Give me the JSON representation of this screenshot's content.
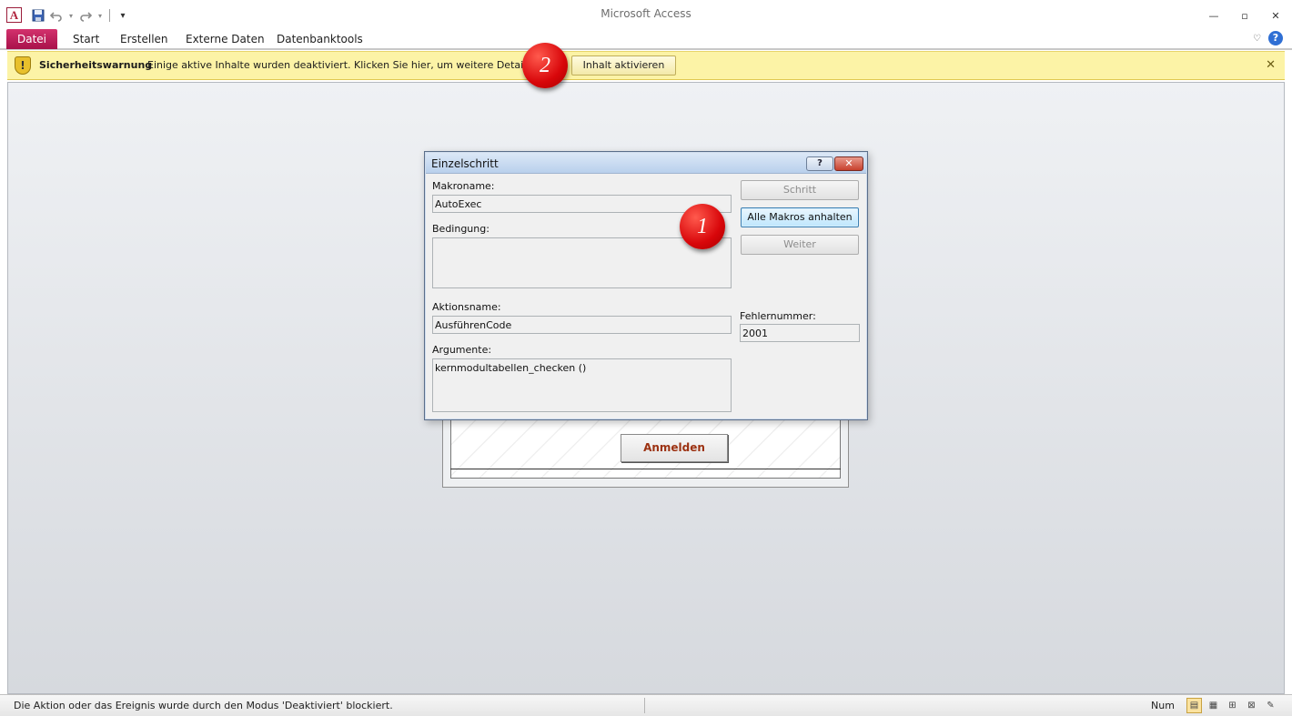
{
  "window": {
    "title": "Microsoft Access",
    "app_icon_letter": "A",
    "minimize": "—",
    "maximize": "▫",
    "close": "✕"
  },
  "quick_access": {
    "save_icon": "save-icon",
    "undo_icon": "undo-icon",
    "redo_icon": "redo-icon",
    "customize_icon": "customize-icon"
  },
  "ribbon": {
    "tabs": [
      {
        "label": "Datei"
      },
      {
        "label": "Start"
      },
      {
        "label": "Erstellen"
      },
      {
        "label": "Externe Daten"
      },
      {
        "label": "Datenbanktools"
      }
    ],
    "help_label": "?"
  },
  "security_bar": {
    "title": "Sicherheitswarnung",
    "message": "Einige aktive Inhalte wurden deaktiviert. Klicken Sie hier, um weitere Details anzuzeigen.",
    "enable_button": "Inhalt aktivieren",
    "close": "✕",
    "shield_glyph": "!"
  },
  "background_form": {
    "login_button": "Anmelden"
  },
  "dialog": {
    "title": "Einzelschritt",
    "help": "?",
    "close": "✕",
    "macro_name_label": "Makroname:",
    "macro_name_value": "AutoExec",
    "condition_label": "Bedingung:",
    "condition_value": "",
    "action_name_label": "Aktionsname:",
    "action_name_value": "AusführenCode",
    "arguments_label": "Argumente:",
    "arguments_value": "kernmodultabellen_checken ()",
    "error_number_label": "Fehlernummer:",
    "error_number_value": "2001",
    "buttons": {
      "step": "Schritt",
      "stop_all": "Alle Makros anhalten",
      "continue": "Weiter"
    }
  },
  "markers": {
    "one": "1",
    "two": "2"
  },
  "statusbar": {
    "message": "Die Aktion oder das Ereignis wurde durch den Modus 'Deaktiviert' blockiert.",
    "num": "Num"
  }
}
